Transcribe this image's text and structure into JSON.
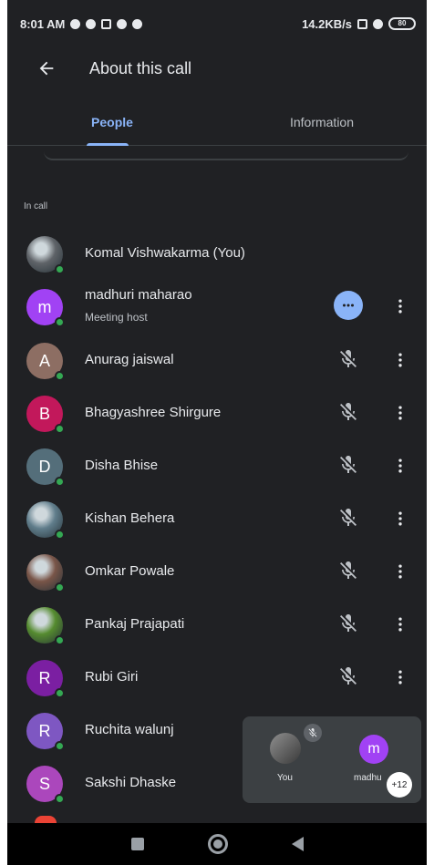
{
  "status": {
    "time": "8:01 AM",
    "speed": "14.2KB/s",
    "battery": "80"
  },
  "header": {
    "title": "About this call"
  },
  "tabs": [
    {
      "label": "People"
    },
    {
      "label": "Information"
    }
  ],
  "section_label": "In call",
  "participants": [
    {
      "name": "Komal Vishwakarma (You)",
      "subtitle": "",
      "initial": "",
      "color": "#5f6368",
      "photo": true,
      "muted": false,
      "host": false
    },
    {
      "name": "madhuri maharao",
      "subtitle": "Meeting host",
      "initial": "m",
      "color": "#a142f4",
      "photo": false,
      "muted": false,
      "host": true
    },
    {
      "name": "Anurag jaiswal",
      "subtitle": "",
      "initial": "A",
      "color": "#8d6e63",
      "photo": false,
      "muted": true,
      "host": false
    },
    {
      "name": "Bhagyashree Shirgure",
      "subtitle": "",
      "initial": "B",
      "color": "#c2185b",
      "photo": false,
      "muted": true,
      "host": false
    },
    {
      "name": "Disha Bhise",
      "subtitle": "",
      "initial": "D",
      "color": "#546e7a",
      "photo": false,
      "muted": true,
      "host": false
    },
    {
      "name": "Kishan Behera",
      "subtitle": "",
      "initial": "",
      "color": "#607d8b",
      "photo": true,
      "muted": true,
      "host": false
    },
    {
      "name": "Omkar Powale",
      "subtitle": "",
      "initial": "",
      "color": "#795548",
      "photo": true,
      "muted": true,
      "host": false
    },
    {
      "name": "Pankaj Prajapati",
      "subtitle": "",
      "initial": "",
      "color": "#558b2f",
      "photo": true,
      "muted": true,
      "host": false
    },
    {
      "name": "Rubi Giri",
      "subtitle": "",
      "initial": "R",
      "color": "#7b1fa2",
      "photo": false,
      "muted": true,
      "host": false
    },
    {
      "name": "Ruchita walunj",
      "subtitle": "",
      "initial": "R",
      "color": "#7e57c2",
      "photo": false,
      "muted": false,
      "host": false
    },
    {
      "name": "Sakshi Dhaske",
      "subtitle": "",
      "initial": "S",
      "color": "#ab47bc",
      "photo": false,
      "muted": false,
      "host": false
    }
  ],
  "pip": {
    "you_label": "You",
    "other_label": "madhu",
    "other_initial": "m",
    "count": "+12"
  },
  "icons": {
    "back": "arrow-left-icon",
    "more": "more-vert-icon",
    "mic_off": "mic-off-icon",
    "host_menu": "more-horiz-icon"
  }
}
